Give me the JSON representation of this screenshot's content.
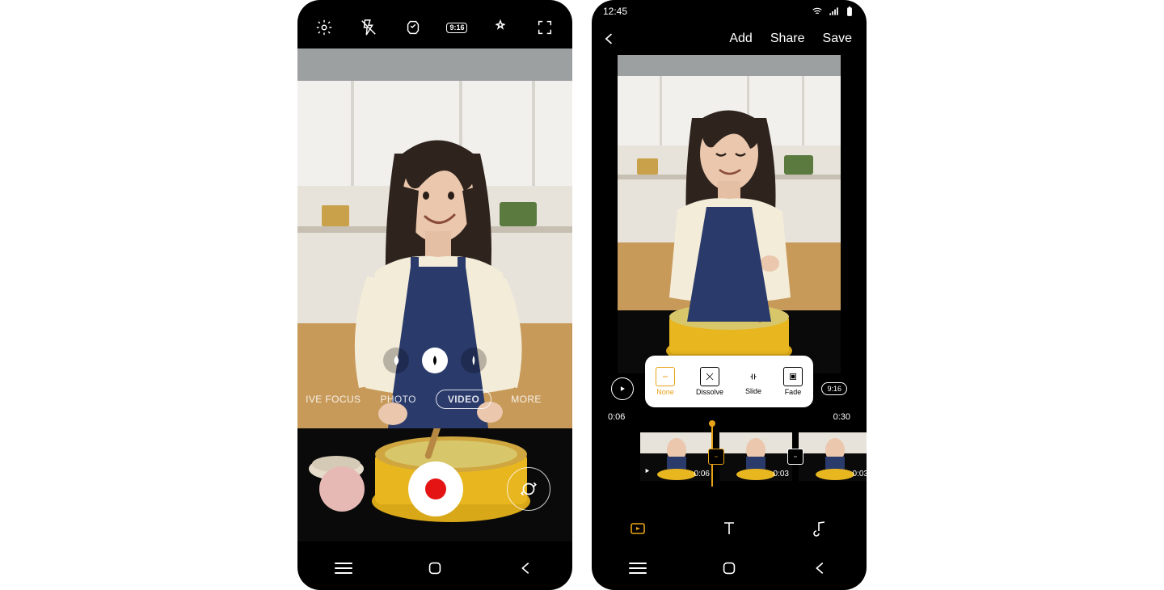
{
  "camera": {
    "icons": {
      "settings": "settings-icon",
      "flash": "flash-off-icon",
      "stabilise": "stabilise-icon",
      "aspect": "9:16",
      "effects": "effects-icon",
      "expand": "expand-icon"
    },
    "zoom": {
      "a": "wide",
      "b": "normal",
      "c": "tele"
    },
    "modes": {
      "live_focus": "IVE FOCUS",
      "photo": "PHOTO",
      "video": "VIDEO",
      "more": "MORE"
    }
  },
  "editor": {
    "status_time": "12:45",
    "actions": {
      "add": "Add",
      "share": "Share",
      "save": "Save"
    },
    "aspect_label": "9:16",
    "time": {
      "current": "0:06",
      "total": "0:30"
    },
    "transitions": {
      "none": "None",
      "dissolve": "Dissolve",
      "slide": "Slide",
      "fade": "Fade"
    },
    "clips": [
      {
        "dur": "0:06"
      },
      {
        "dur": "0:03"
      },
      {
        "dur": "0:03"
      }
    ]
  }
}
